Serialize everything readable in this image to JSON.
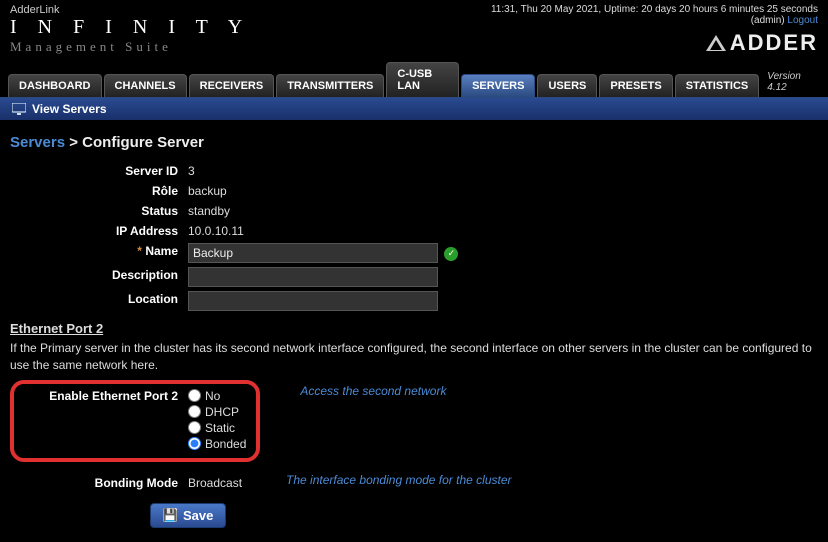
{
  "header": {
    "small_brand": "AdderLink",
    "product": "I N F I N I T Y",
    "suite": "Management Suite",
    "time_line": "11:31, Thu 20 May 2021,   Uptime: 20 days 20 hours 6 minutes 25 seconds",
    "user_prefix": "(admin) ",
    "logout": "Logout",
    "logo_text": "ADDER"
  },
  "tabs": {
    "items": [
      "DASHBOARD",
      "CHANNELS",
      "RECEIVERS",
      "TRANSMITTERS",
      "C-USB LAN",
      "SERVERS",
      "USERS",
      "PRESETS",
      "STATISTICS"
    ],
    "active_index": 5,
    "version": "Version 4.12"
  },
  "subbar": {
    "label": "View Servers"
  },
  "breadcrumb": {
    "link": "Servers",
    "sep": ">",
    "current": "Configure Server"
  },
  "form": {
    "server_id": {
      "label": "Server ID",
      "value": "3"
    },
    "role": {
      "label": "Rôle",
      "value": "backup"
    },
    "status": {
      "label": "Status",
      "value": "standby"
    },
    "ip": {
      "label": "IP Address",
      "value": "10.0.10.11"
    },
    "name": {
      "label": "Name",
      "value": "Backup",
      "required_mark": "*"
    },
    "description": {
      "label": "Description",
      "value": ""
    },
    "location": {
      "label": "Location",
      "value": ""
    }
  },
  "eth2": {
    "title": "Ethernet Port 2",
    "help": "If the Primary server in the cluster has its second network interface configured, the second interface on other servers in the cluster can be configured to use the same network here.",
    "enable_label": "Enable Ethernet Port 2",
    "options": [
      "No",
      "DHCP",
      "Static",
      "Bonded"
    ],
    "selected_index": 3,
    "hint": "Access the second network"
  },
  "bonding": {
    "label": "Bonding Mode",
    "value": "Broadcast",
    "hint": "The interface bonding mode for the cluster"
  },
  "save": {
    "label": "Save"
  }
}
